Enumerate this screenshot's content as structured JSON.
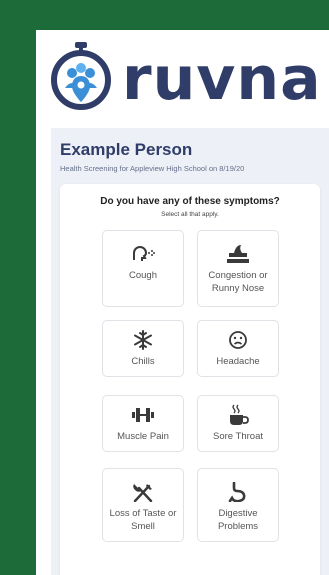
{
  "brand": {
    "wordmark": "ruvna",
    "logo_icon": "stopwatch-people-pin-logo"
  },
  "header": {
    "person_name": "Example Person",
    "subtitle": "Health Screening for Appleview High School on 8/19/20"
  },
  "screening": {
    "question": "Do you have any of these symptoms?",
    "instruction": "Select all that apply.",
    "symptoms": [
      {
        "label": "Cough",
        "icon": "cough-icon"
      },
      {
        "label": "Congestion or Runny Nose",
        "icon": "tissue-box-icon"
      },
      {
        "label": "Chills",
        "icon": "snowflake-icon"
      },
      {
        "label": "Headache",
        "icon": "frown-face-icon"
      },
      {
        "label": "Muscle Pain",
        "icon": "dumbbell-icon"
      },
      {
        "label": "Sore Throat",
        "icon": "hot-drink-icon"
      },
      {
        "label": "Loss of Taste or Smell",
        "icon": "utensils-crossed-icon"
      },
      {
        "label": "Digestive Problems",
        "icon": "stomach-icon"
      }
    ]
  },
  "colors": {
    "background": "#1e6b3a",
    "brand_navy": "#2f3d68",
    "brand_blue": "#3a8fd6",
    "panel_bg": "#eef0f8"
  }
}
